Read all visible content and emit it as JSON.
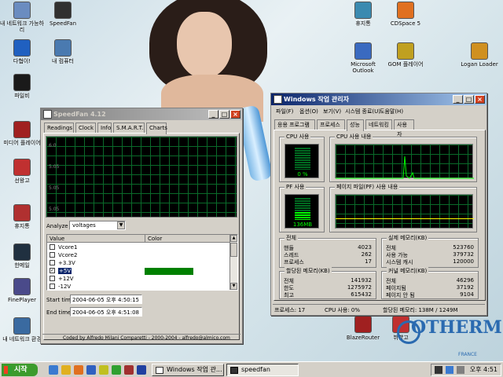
{
  "desktop": {
    "icons_left": [
      {
        "label": "내 네트워크 가능하리",
        "color": "#6a8cc0"
      },
      {
        "label": "SpeedFan",
        "color": "#303030"
      },
      {
        "label": "다협이!",
        "color": "#2060c0"
      },
      {
        "label": "내 컴퓨터",
        "color": "#4a7ab0"
      },
      {
        "label": "파일비",
        "color": "#1a1a1a"
      },
      {
        "label": "미디어 플레이어",
        "color": "#a02020"
      },
      {
        "label": "선왕고",
        "color": "#c03030"
      },
      {
        "label": "휴지통",
        "color": "#b03030"
      },
      {
        "label": "한메일",
        "color": "#203040"
      },
      {
        "label": "FinePlayer",
        "color": "#4a4a8a"
      },
      {
        "label": "내 네트워크 환경",
        "color": "#3a6aa0"
      }
    ],
    "icons_right": [
      {
        "label": "휴지통",
        "color": "#3a8ab0"
      },
      {
        "label": "CDSpace 5",
        "color": "#e07020"
      },
      {
        "label": "Microsoft Outlook",
        "color": "#3a6ac0"
      },
      {
        "label": "GOM 플레이어",
        "color": "#c0a020"
      },
      {
        "label": "Logan Loader",
        "color": "#d09020"
      },
      {
        "label": "BlazeRouter",
        "color": "#a02020"
      },
      {
        "label": "뷔향고",
        "color": "#c03030"
      }
    ],
    "brand_text": "OTHERM",
    "brand_sub": "FRANCE",
    "brand_color": "#2a6ab0"
  },
  "speedfan": {
    "title": "SpeedFan 4.12",
    "tabs": [
      "Readings",
      "Clock",
      "Info",
      "S.M.A.R.T.",
      "Charts"
    ],
    "selected_tab": "Charts",
    "y_labels": [
      "6.0",
      "5.05",
      "5.05",
      "5.05"
    ],
    "analyze_label": "Analyze",
    "analyze_value": "voltages",
    "col_value": "Value",
    "col_color": "Color",
    "rows": [
      {
        "label": "Vcore1",
        "checked": false
      },
      {
        "label": "Vcore2",
        "checked": false
      },
      {
        "label": "+3.3V",
        "checked": false
      },
      {
        "label": "+5V",
        "checked": true,
        "selected": true
      },
      {
        "label": "+12V",
        "checked": false
      },
      {
        "label": "-12V",
        "checked": false
      }
    ],
    "selected_color": "#008000",
    "start_label": "Start time",
    "start_value": "2004-06-05 오후 4:50:15",
    "end_label": "End time",
    "end_value": "2004-06-05 오후 4:51:08",
    "footer": "Coded by Alfredo Milani Comparetti - 2000-2004 - alfredo@almico.com"
  },
  "taskmgr": {
    "title": "Windows 작업 관리자",
    "menu": [
      "파일(F)",
      "옵션(O)",
      "보기(V)",
      "시스템 종료(U)",
      "도움말(H)"
    ],
    "tabs": [
      "응용 프로그램",
      "프로세스",
      "성능",
      "네트워킹",
      "사용자"
    ],
    "selected_tab": "성능",
    "cpu_usage_label": "CPU 사용",
    "cpu_usage_value": "0 %",
    "cpu_usage_pct": 0,
    "cpu_history_label": "CPU 사용 내용",
    "pf_label": "PF 사용",
    "pf_value": "136MB",
    "pf_history_label": "페이지 파일(PF) 사용 내용",
    "totals": {
      "caption": "전체",
      "rows": [
        [
          "핸들",
          "4023"
        ],
        [
          "스레드",
          "262"
        ],
        [
          "프로세스",
          "17"
        ]
      ]
    },
    "physical": {
      "caption": "실제 메모리(KB)",
      "rows": [
        [
          "전체",
          "523760"
        ],
        [
          "사용 가능",
          "379732"
        ],
        [
          "시스템 캐시",
          "120000"
        ]
      ]
    },
    "commit": {
      "caption": "할당된 메모리(KB)",
      "rows": [
        [
          "전체",
          "141932"
        ],
        [
          "한도",
          "1275972"
        ],
        [
          "최고",
          "615432"
        ]
      ]
    },
    "kernel": {
      "caption": "커널 메모리(KB)",
      "rows": [
        [
          "전체",
          "46296"
        ],
        [
          "페이지됨",
          "37192"
        ],
        [
          "페이지 안 됨",
          "9104"
        ]
      ]
    },
    "status": [
      "프로세스: 17",
      "CPU 사용: 0%",
      "할당된 메모리: 138M / 1249M"
    ]
  },
  "taskbar": {
    "start": "시작",
    "buttons": [
      "Windows 작업 관...",
      "speedfan"
    ],
    "time": "오후 4:51"
  }
}
